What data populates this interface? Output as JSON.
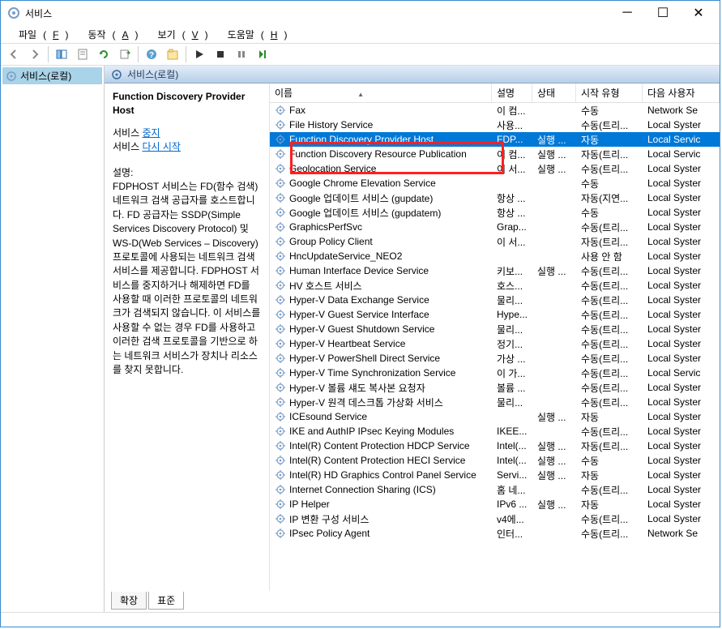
{
  "window": {
    "title": "서비스"
  },
  "menubar": {
    "items": [
      {
        "label": "파일",
        "hotkey": "F"
      },
      {
        "label": "동작",
        "hotkey": "A"
      },
      {
        "label": "보기",
        "hotkey": "V"
      },
      {
        "label": "도움말",
        "hotkey": "H"
      }
    ]
  },
  "tree": {
    "root": "서비스(로컬)"
  },
  "panel_title": "서비스(로컬)",
  "detail": {
    "selected_name": "Function Discovery Provider Host",
    "action_prefix": "서비스 ",
    "action_stop": "중지",
    "action_restart": "다시 시작",
    "desc_label": "설명:",
    "desc_text": "FDPHOST 서비스는 FD(함수 검색) 네트워크 검색 공급자를 호스트합니다. FD 공급자는 SSDP(Simple Services Discovery Protocol) 및 WS-D(Web Services – Discovery) 프로토콜에 사용되는 네트워크 검색 서비스를 제공합니다. FDPHOST 서비스를 중지하거나 해제하면 FD를 사용할 때 이러한 프로토콜의 네트워크가 검색되지 않습니다. 이 서비스를 사용할 수 없는 경우 FD를 사용하고 이러한 검색 프로토콜을 기반으로 하는 네트워크 서비스가 장치나 리소스를 찾지 못합니다."
  },
  "columns": {
    "name": "이름",
    "desc": "설명",
    "state": "상태",
    "start": "시작 유형",
    "logon": "다음 사용자"
  },
  "rows": [
    {
      "name": "Fax",
      "desc": "이 컴...",
      "state": "",
      "start": "수동",
      "logon": "Network Se",
      "selected": false
    },
    {
      "name": "File History Service",
      "desc": "사용...",
      "state": "",
      "start": "수동(트리...",
      "logon": "Local Syster",
      "selected": false
    },
    {
      "name": "Function Discovery Provider Host",
      "desc": "FDP...",
      "state": "실행 ...",
      "start": "자동",
      "logon": "Local Servic",
      "selected": true
    },
    {
      "name": "Function Discovery Resource Publication",
      "desc": "이 컴...",
      "state": "실행 ...",
      "start": "자동(트리...",
      "logon": "Local Servic",
      "selected": false
    },
    {
      "name": "Geolocation Service",
      "desc": "이 서...",
      "state": "실행 ...",
      "start": "수동(트리...",
      "logon": "Local Syster",
      "selected": false
    },
    {
      "name": "Google Chrome Elevation Service",
      "desc": "",
      "state": "",
      "start": "수동",
      "logon": "Local Syster",
      "selected": false
    },
    {
      "name": "Google 업데이트 서비스 (gupdate)",
      "desc": "항상 ...",
      "state": "",
      "start": "자동(지연...",
      "logon": "Local Syster",
      "selected": false
    },
    {
      "name": "Google 업데이트 서비스 (gupdatem)",
      "desc": "항상 ...",
      "state": "",
      "start": "수동",
      "logon": "Local Syster",
      "selected": false
    },
    {
      "name": "GraphicsPerfSvc",
      "desc": "Grap...",
      "state": "",
      "start": "수동(트리...",
      "logon": "Local Syster",
      "selected": false
    },
    {
      "name": "Group Policy Client",
      "desc": "이 서...",
      "state": "",
      "start": "자동(트리...",
      "logon": "Local Syster",
      "selected": false
    },
    {
      "name": "HncUpdateService_NEO2",
      "desc": "",
      "state": "",
      "start": "사용 안 함",
      "logon": "Local Syster",
      "selected": false
    },
    {
      "name": "Human Interface Device Service",
      "desc": "키보...",
      "state": "실행 ...",
      "start": "수동(트리...",
      "logon": "Local Syster",
      "selected": false
    },
    {
      "name": "HV 호스트 서비스",
      "desc": "호스...",
      "state": "",
      "start": "수동(트리...",
      "logon": "Local Syster",
      "selected": false
    },
    {
      "name": "Hyper-V Data Exchange Service",
      "desc": "물리...",
      "state": "",
      "start": "수동(트리...",
      "logon": "Local Syster",
      "selected": false
    },
    {
      "name": "Hyper-V Guest Service Interface",
      "desc": "Hype...",
      "state": "",
      "start": "수동(트리...",
      "logon": "Local Syster",
      "selected": false
    },
    {
      "name": "Hyper-V Guest Shutdown Service",
      "desc": "물리...",
      "state": "",
      "start": "수동(트리...",
      "logon": "Local Syster",
      "selected": false
    },
    {
      "name": "Hyper-V Heartbeat Service",
      "desc": "정기...",
      "state": "",
      "start": "수동(트리...",
      "logon": "Local Syster",
      "selected": false
    },
    {
      "name": "Hyper-V PowerShell Direct Service",
      "desc": "가상 ...",
      "state": "",
      "start": "수동(트리...",
      "logon": "Local Syster",
      "selected": false
    },
    {
      "name": "Hyper-V Time Synchronization Service",
      "desc": "이 가...",
      "state": "",
      "start": "수동(트리...",
      "logon": "Local Servic",
      "selected": false
    },
    {
      "name": "Hyper-V 볼륨 섀도 복사본 요청자",
      "desc": "볼륨 ...",
      "state": "",
      "start": "수동(트리...",
      "logon": "Local Syster",
      "selected": false
    },
    {
      "name": "Hyper-V 원격 데스크톱 가상화 서비스",
      "desc": "물리...",
      "state": "",
      "start": "수동(트리...",
      "logon": "Local Syster",
      "selected": false
    },
    {
      "name": "ICEsound Service",
      "desc": "",
      "state": "실행 ...",
      "start": "자동",
      "logon": "Local Syster",
      "selected": false
    },
    {
      "name": "IKE and AuthIP IPsec Keying Modules",
      "desc": "IKEE...",
      "state": "",
      "start": "수동(트리...",
      "logon": "Local Syster",
      "selected": false
    },
    {
      "name": "Intel(R) Content Protection HDCP Service",
      "desc": "Intel(...",
      "state": "실행 ...",
      "start": "자동(트리...",
      "logon": "Local Syster",
      "selected": false
    },
    {
      "name": "Intel(R) Content Protection HECI Service",
      "desc": "Intel(...",
      "state": "실행 ...",
      "start": "수동",
      "logon": "Local Syster",
      "selected": false
    },
    {
      "name": "Intel(R) HD Graphics Control Panel Service",
      "desc": "Servi...",
      "state": "실행 ...",
      "start": "자동",
      "logon": "Local Syster",
      "selected": false
    },
    {
      "name": "Internet Connection Sharing (ICS)",
      "desc": "홈 네...",
      "state": "",
      "start": "수동(트리...",
      "logon": "Local Syster",
      "selected": false
    },
    {
      "name": "IP Helper",
      "desc": "IPv6 ...",
      "state": "실행 ...",
      "start": "자동",
      "logon": "Local Syster",
      "selected": false
    },
    {
      "name": "IP 변환 구성 서비스",
      "desc": "v4에...",
      "state": "",
      "start": "수동(트리...",
      "logon": "Local Syster",
      "selected": false
    },
    {
      "name": "IPsec Policy Agent",
      "desc": "인터...",
      "state": "",
      "start": "수동(트리...",
      "logon": "Network Se",
      "selected": false
    }
  ],
  "tabs": {
    "extended": "확장",
    "standard": "표준"
  }
}
